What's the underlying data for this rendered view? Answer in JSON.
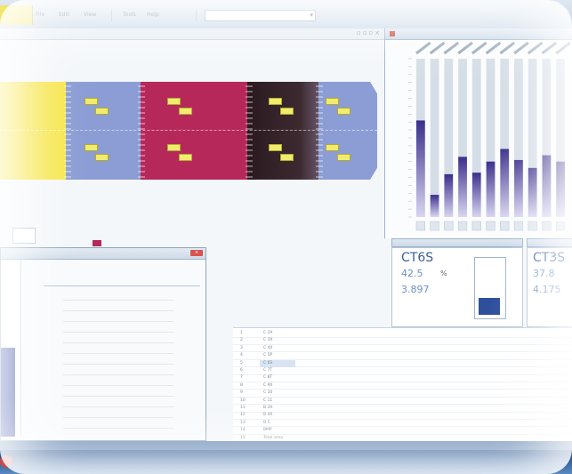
{
  "toolbar": {
    "items": [
      "File",
      "Edit",
      "View",
      "Tools",
      "Help"
    ],
    "combo_value": ""
  },
  "chart_panel": {
    "title": ""
  },
  "chart_data": {
    "type": "bar",
    "title": "",
    "categories": [
      "1",
      "2",
      "3",
      "4",
      "5",
      "6",
      "7",
      "8",
      "9",
      "10",
      "11"
    ],
    "values": [
      61,
      14,
      27,
      38,
      28,
      35,
      43,
      36,
      31,
      39,
      35
    ],
    "ylim": [
      0,
      100
    ],
    "grid": true,
    "legend": "none"
  },
  "measurements": [
    {
      "name": "CT6S",
      "value1": "42.5",
      "value2": "3.897",
      "unit": "%",
      "fill": 0.32
    },
    {
      "name": "CT3S",
      "value1": "37.8",
      "value2": "4.175",
      "unit": "%",
      "fill": 0.0
    }
  ],
  "dialog": {
    "tabs": [
      "",
      "",
      ""
    ]
  },
  "grid_rows": [
    [
      "1",
      "C 2X"
    ],
    [
      "2",
      "C 3X"
    ],
    [
      "3",
      "C 4X"
    ],
    [
      "4",
      "C 5P"
    ],
    [
      "5",
      "C 6S"
    ],
    [
      "6",
      "C 7T"
    ],
    [
      "7",
      "C 8T"
    ],
    [
      "8",
      "C 9X"
    ],
    [
      "9",
      "C 10"
    ],
    [
      "10",
      "C 11"
    ],
    [
      "11",
      "B 3X"
    ],
    [
      "12",
      "B 4X"
    ],
    [
      "13",
      "B 5"
    ],
    [
      "14",
      "BMP"
    ],
    [
      "15",
      "Total area"
    ]
  ]
}
